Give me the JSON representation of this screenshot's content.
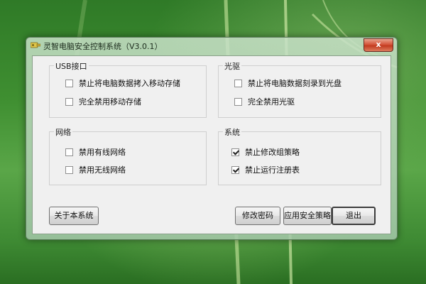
{
  "window": {
    "title": "灵智电脑安全控制系统（V3.0.1）",
    "close_label": "x"
  },
  "groups": {
    "usb": {
      "title": "USB接口",
      "options": [
        {
          "label": "禁止将电脑数据拷入移动存储",
          "checked": false
        },
        {
          "label": "完全禁用移动存储",
          "checked": false
        }
      ]
    },
    "optical": {
      "title": "光驱",
      "options": [
        {
          "label": "禁止将电脑数据刻录到光盘",
          "checked": false
        },
        {
          "label": "完全禁用光驱",
          "checked": false
        }
      ]
    },
    "network": {
      "title": "网络",
      "options": [
        {
          "label": "禁用有线网络",
          "checked": false
        },
        {
          "label": "禁用无线网络",
          "checked": false
        }
      ]
    },
    "system": {
      "title": "系统",
      "options": [
        {
          "label": "禁止修改组策略",
          "checked": true
        },
        {
          "label": "禁止运行注册表",
          "checked": true
        }
      ]
    }
  },
  "buttons": {
    "about": "关于本系统",
    "change_password": "修改密码",
    "apply_policy": "应用安全策略",
    "exit": "退出"
  }
}
